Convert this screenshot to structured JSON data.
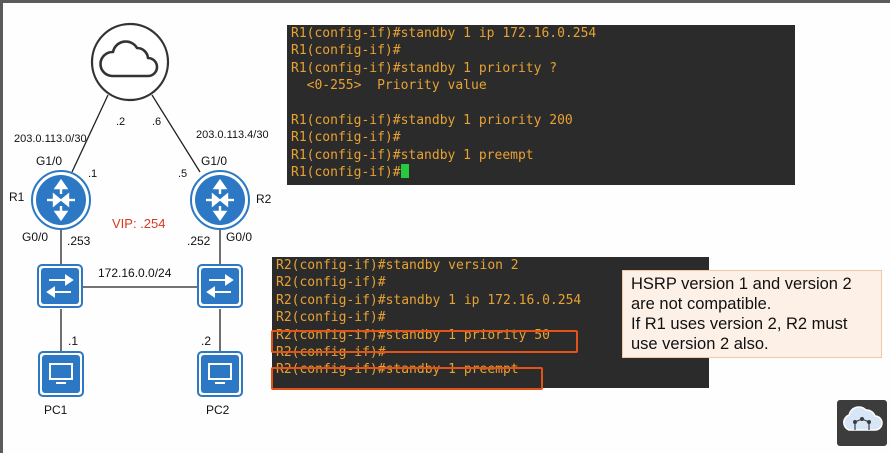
{
  "diagram": {
    "internet": {
      "icon": "cloud-icon"
    },
    "link_left": {
      "subnet": "203.0.113.0/30",
      "cloud_ip": ".2",
      "router_ip": ".1"
    },
    "link_right": {
      "subnet": "203.0.113.4/30",
      "cloud_ip": ".6",
      "router_ip": ".5"
    },
    "r1": {
      "name": "R1",
      "wan_iface": "G1/0",
      "lan_iface": "G0/0",
      "lan_ip": ".253",
      "icon": "router-icon"
    },
    "r2": {
      "name": "R2",
      "wan_iface": "G1/0",
      "lan_iface": "G0/0",
      "lan_ip": ".252",
      "icon": "router-icon"
    },
    "vip": "VIP: .254",
    "lan_subnet": "172.16.0.0/24",
    "pc1": {
      "name": "PC1",
      "ip": ".1",
      "icon": "pc-icon"
    },
    "pc2": {
      "name": "PC2",
      "ip": ".2",
      "icon": "pc-icon"
    },
    "switch_icon": "switch-icon"
  },
  "terminal_r1": {
    "lines": [
      "R1(config-if)#standby 1 ip 172.16.0.254",
      "R1(config-if)#",
      "R1(config-if)#standby 1 priority ?",
      "  <0-255>  Priority value",
      "",
      "R1(config-if)#standby 1 priority 200",
      "R1(config-if)#",
      "R1(config-if)#standby 1 preempt",
      "R1(config-if)#"
    ]
  },
  "terminal_r2": {
    "lines": [
      "R2(config-if)#standby version 2",
      "R2(config-if)#",
      "R2(config-if)#standby 1 ip 172.16.0.254",
      "R2(config-if)#",
      "R2(config-if)#standby 1 priority 50",
      "R2(config-if)#",
      "R2(config-if)#standby 1 preempt"
    ],
    "highlighted_lines": [
      4,
      6
    ]
  },
  "note": {
    "line1": "HSRP version 1 and version 2",
    "line2": "are not compatible.",
    "line3": "If R1 uses version 2, R2 must",
    "line4": "use version 2 also."
  },
  "colors": {
    "device_blue": "#2c78c4",
    "terminal_bg": "#2b2b2b",
    "terminal_text": "#e8a233",
    "highlight": "#e25317",
    "vip_red": "#d9391f",
    "note_bg": "#fdf0e6"
  },
  "logo": {
    "icon": "cloud-network-logo-icon"
  }
}
